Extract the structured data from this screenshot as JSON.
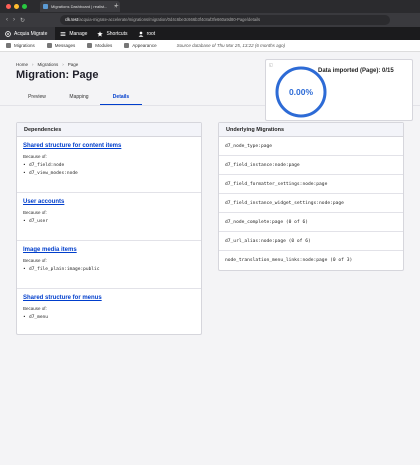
{
  "browser": {
    "tab_title": "Migrations Dashboard | realist...",
    "tab_close": "×",
    "new_tab": "+",
    "nav_back": "‹",
    "nav_forward": "›",
    "nav_reload": "↻",
    "url_host": "clk.test",
    "url_path": "/acquia-migrate-accelerate/migrations/migration/0d4c6be3c666b3f4c8af3fe660a9d80-Page/details"
  },
  "toolbar": {
    "brand": "Acquia Migrate",
    "manage": "Manage",
    "shortcuts": "Shortcuts",
    "user": "root"
  },
  "subtoolbar": {
    "migrations": "Migrations",
    "messages": "Messages",
    "modules": "Modules",
    "appearance": "Appearance",
    "source_note": "Source database of Thu Mar 25, 13:22 (6 months ago)"
  },
  "breadcrumb": [
    "Home",
    "Migrations",
    "Page"
  ],
  "breadcrumb_sep": "›",
  "page_title": "Migration: Page",
  "tabs": [
    "Preview",
    "Mapping",
    "Details"
  ],
  "active_tab": "Details",
  "status": {
    "corner_icon": "◱",
    "percent": "0.00%",
    "progress": 0,
    "label": "Data imported (Page): 0/15",
    "gauge_color": "#2d6bd6"
  },
  "dependencies": {
    "heading": "Dependencies",
    "because_label": "Because of:",
    "items": [
      {
        "title": "Shared structure for content items",
        "because": [
          "d7_field:node",
          "d7_view_modes:node"
        ]
      },
      {
        "title": "User accounts",
        "because": [
          "d7_user"
        ]
      },
      {
        "title": "Image media items",
        "because": [
          "d7_file_plain:image:public"
        ]
      },
      {
        "title": "Shared structure for menus",
        "because": [
          "d7_menu"
        ]
      }
    ]
  },
  "underlying": {
    "heading": "Underlying Migrations",
    "items": [
      "d7_node_type:page",
      "d7_field_instance:node:page",
      "d7_field_formatter_settings:node:page",
      "d7_field_instance_widget_settings:node:page",
      "d7_node_complete:page (0 of 6)",
      "d7_url_alias:node:page (0 of 6)",
      "node_translation_menu_links:node:page (0 of 3)"
    ]
  },
  "colors": {
    "accent": "#003ecc",
    "toolbar_bg": "#1b1b1d"
  }
}
